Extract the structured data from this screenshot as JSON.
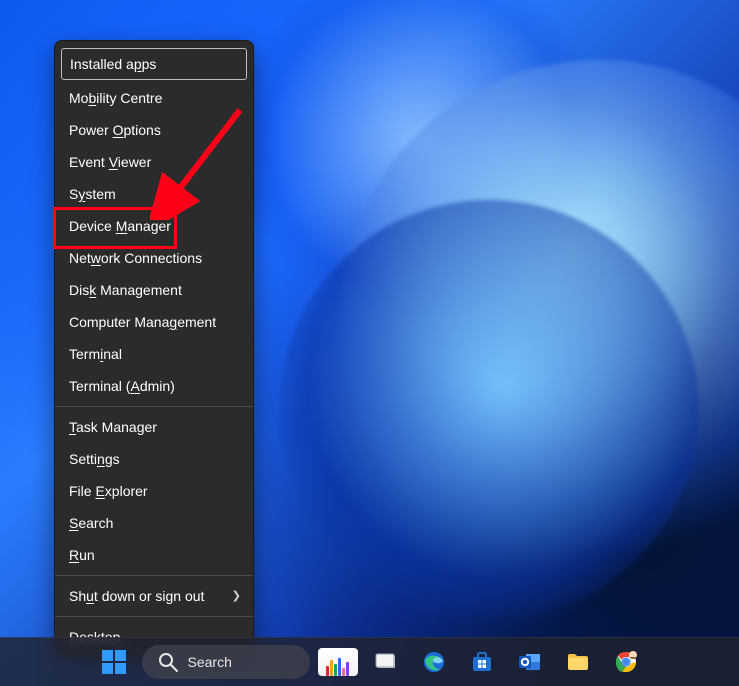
{
  "menu": {
    "groups": [
      [
        {
          "pre": "Installed a",
          "u": "p",
          "post": "ps",
          "name": "menu-installed-apps",
          "first": true
        },
        {
          "pre": "Mo",
          "u": "b",
          "post": "ility Centre",
          "name": "menu-mobility-centre"
        },
        {
          "pre": "Power ",
          "u": "O",
          "post": "ptions",
          "name": "menu-power-options"
        },
        {
          "pre": "Event ",
          "u": "V",
          "post": "iewer",
          "name": "menu-event-viewer"
        },
        {
          "pre": "S",
          "u": "y",
          "post": "stem",
          "name": "menu-system"
        },
        {
          "pre": "Device ",
          "u": "M",
          "post": "anager",
          "name": "menu-device-manager",
          "highlight": true
        },
        {
          "pre": "Net",
          "u": "w",
          "post": "ork Connections",
          "name": "menu-network-connections"
        },
        {
          "pre": "Dis",
          "u": "k",
          "post": " Management",
          "name": "menu-disk-management"
        },
        {
          "pre": "Computer Mana",
          "u": "g",
          "post": "ement",
          "name": "menu-computer-management"
        },
        {
          "pre": "Term",
          "u": "i",
          "post": "nal",
          "name": "menu-terminal"
        },
        {
          "pre": "Terminal (",
          "u": "A",
          "post": "dmin)",
          "name": "menu-terminal-admin"
        }
      ],
      [
        {
          "pre": "",
          "u": "T",
          "post": "ask Manager",
          "name": "menu-task-manager"
        },
        {
          "pre": "Setti",
          "u": "n",
          "post": "gs",
          "name": "menu-settings"
        },
        {
          "pre": "File ",
          "u": "E",
          "post": "xplorer",
          "name": "menu-file-explorer"
        },
        {
          "pre": "",
          "u": "S",
          "post": "earch",
          "name": "menu-search"
        },
        {
          "pre": "",
          "u": "R",
          "post": "un",
          "name": "menu-run"
        }
      ],
      [
        {
          "pre": "Sh",
          "u": "u",
          "post": "t down or sign out",
          "name": "menu-shutdown-signout",
          "submenu": true
        }
      ],
      [
        {
          "pre": "",
          "u": "D",
          "post": "esktop",
          "name": "menu-desktop"
        }
      ]
    ]
  },
  "taskbar": {
    "search_placeholder": "Search"
  }
}
